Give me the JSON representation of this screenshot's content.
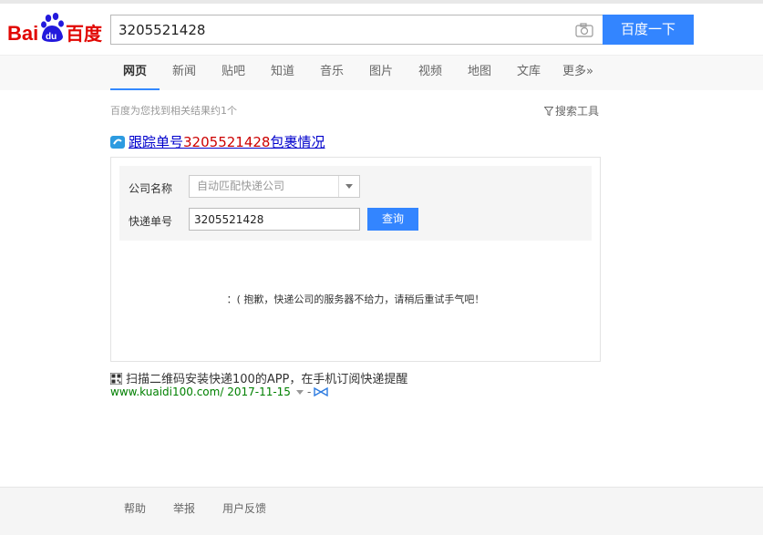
{
  "logo": {
    "text_bai": "Bai",
    "text_du": "du",
    "text_cn": "百度"
  },
  "search": {
    "query": "3205521428",
    "button_label": "百度一下"
  },
  "tabs": [
    "网页",
    "新闻",
    "贴吧",
    "知道",
    "音乐",
    "图片",
    "视频",
    "地图",
    "文库",
    "更多»"
  ],
  "result_count": "百度为您找到相关结果约1个",
  "search_tools": "搜索工具",
  "result": {
    "title_prefix": "跟踪单号",
    "title_number": "3205521428",
    "title_suffix": "包裹情况"
  },
  "form": {
    "company_label": "公司名称",
    "company_value": "自动匹配快递公司",
    "number_label": "快递单号",
    "number_value": "3205521428",
    "query_button": "查询",
    "error_message": "：( 抱歉，快递公司的服务器不给力，请稍后重试手气吧！"
  },
  "qr_text": "扫描二维码安装快递100的APP，在手机订阅快递提醒",
  "url": {
    "link": "www.kuaidi100.com/",
    "date": "2017-11-15",
    "sep": "-"
  },
  "footer": [
    "帮助",
    "举报",
    "用户反馈"
  ],
  "colors": {
    "accent": "#3385ff",
    "link": "#0000cc",
    "highlight": "#cc0000",
    "url_green": "#008000"
  }
}
